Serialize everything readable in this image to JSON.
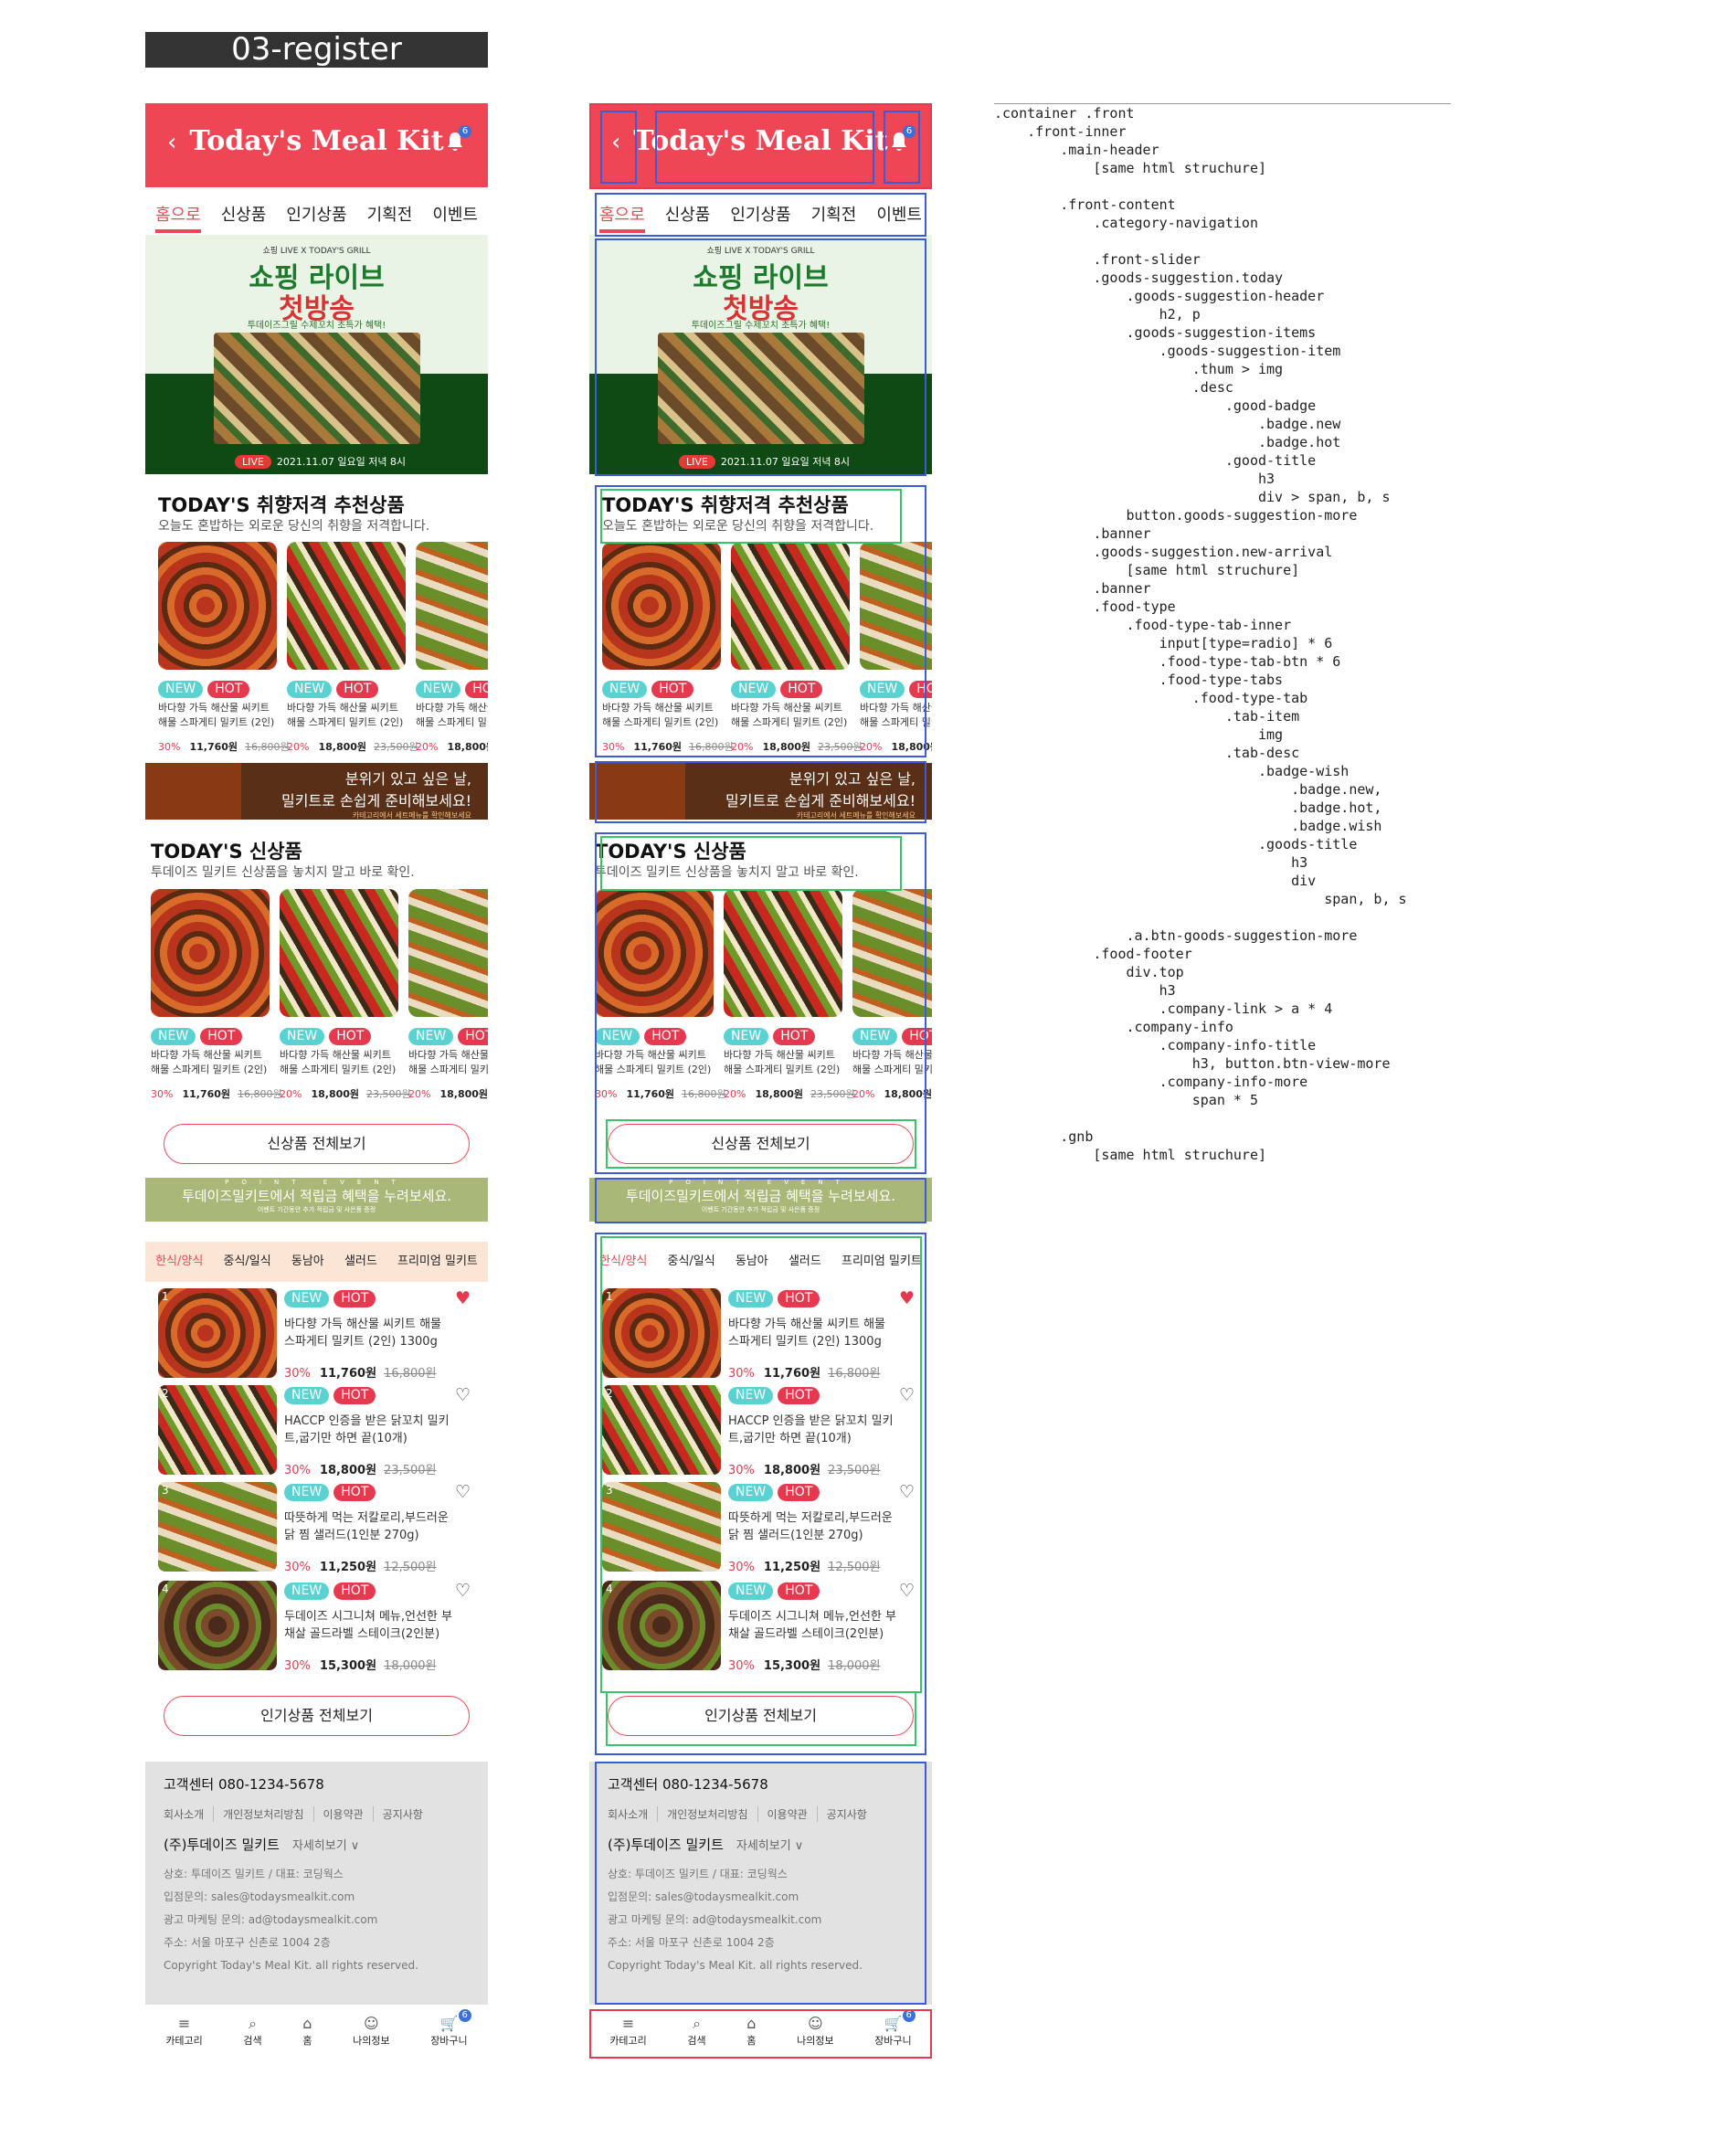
{
  "frame_title": "03-register",
  "header": {
    "back": "‹",
    "logo": "Today's Meal Kit",
    "notif_count": "6"
  },
  "categories": [
    "홈으로",
    "신상품",
    "인기상품",
    "기획전",
    "이벤트"
  ],
  "hero": {
    "tag": "쇼핑 LIVE X TODAY'S GRILL",
    "title1": "쇼핑 라이브",
    "title2": "첫방송",
    "sub": "투데이즈그릴 수제꼬치 초특가 혜택!",
    "live_label": "LIVE",
    "live_date": "2021.11.07 일요일 저녁 8시"
  },
  "today": {
    "title": "TODAY'S 취향저격 추천상품",
    "sub": "오늘도 혼밥하는 외로운 당신의 취향을 저격합니다.",
    "items": [
      {
        "new": "NEW",
        "hot": "HOT",
        "name": "바다향 가득 해산물 씨키트 해물 스파게티 밀키트 (2인)",
        "pct": "30%",
        "price": "11,760원",
        "old": "16,800원"
      },
      {
        "new": "NEW",
        "hot": "HOT",
        "name": "바다향 가득 해산물 씨키트 해물 스파게티 밀키트 (2인)",
        "pct": "20%",
        "price": "18,800원",
        "old": "23,500원"
      },
      {
        "new": "NEW",
        "hot": "HOT",
        "name": "바다향 가득 해산물 씨키트 해물 스파게티 밀키트",
        "pct": "20%",
        "price": "18,800원",
        "old": ""
      }
    ]
  },
  "banner1": {
    "l1": "분위기 있고 싶은 날,",
    "l2": "밀키트로 손쉽게 준비해보세요!",
    "l3": "카테고리에서 세트메뉴를 확인해보세요"
  },
  "new_arrival": {
    "title": "TODAY'S 신상품",
    "sub": "투데이즈 밀키트 신상품을 놓치지 말고 바로 확인.",
    "items": [
      {
        "new": "NEW",
        "hot": "HOT",
        "name": "바다향 가득 해산물 씨키트 해물 스파게티 밀키트 (2인)",
        "pct": "30%",
        "price": "11,760원",
        "old": "16,800원"
      },
      {
        "new": "NEW",
        "hot": "HOT",
        "name": "바다향 가득 해산물 씨키트 해물 스파게티 밀키트 (2인)",
        "pct": "20%",
        "price": "18,800원",
        "old": "23,500원"
      },
      {
        "new": "NEW",
        "hot": "HOT",
        "name": "바다향 가득 해산물 씨키트 해물 스파게티 밀키트",
        "pct": "20%",
        "price": "18,800원",
        "old": ""
      }
    ],
    "more": "신상품 전체보기"
  },
  "banner2": {
    "pt": "POINT EVENT",
    "l1": "투데이즈밀키트에서 적립금 혜택을 누려보세요.",
    "l2": "이벤트 기간동안 추가 적립금 및 사은품 증정"
  },
  "food_tabs": [
    "한식/양식",
    "중식/일식",
    "동남아",
    "샐러드",
    "프리미엄 밀키트"
  ],
  "ranking": [
    {
      "rank": "1",
      "new": "NEW",
      "hot": "HOT",
      "name": "바다향 가득 해산물 씨키트 해물 스파게티 밀키트 (2인) 1300g",
      "pct": "30%",
      "price": "11,760원",
      "old": "16,800원"
    },
    {
      "rank": "2",
      "new": "NEW",
      "hot": "HOT",
      "name": "HACCP 인증을 받은 닭꼬치 밀키트,굽기만 하면 끝(10개)",
      "pct": "30%",
      "price": "18,800원",
      "old": "23,500원"
    },
    {
      "rank": "3",
      "new": "NEW",
      "hot": "HOT",
      "name": "따뜻하게 먹는 저칼로리,부드러운 닭 찜 샐러드(1인분 270g)",
      "pct": "30%",
      "price": "11,250원",
      "old": "12,500원"
    },
    {
      "rank": "4",
      "new": "NEW",
      "hot": "HOT",
      "name": "두데이즈 시그니쳐 메뉴,언선한 부채살 골드라벨 스테이크(2인분)",
      "pct": "30%",
      "price": "15,300원",
      "old": "18,000원"
    }
  ],
  "ranking_more": "인기상품 전체보기",
  "footer": {
    "cc": "고객센터 080-1234-5678",
    "links": [
      "회사소개",
      "개인정보처리방침",
      "이용약관",
      "공지사항"
    ],
    "company": "(주)투데이즈 밀키트",
    "detail": "자세히보기 ∨",
    "info": [
      "상호: 투데이즈 밀키트 / 대표: 코딩웍스",
      "입점문의: sales@todaysmealkit.com",
      "광고 마케팅 문의: ad@todaysmealkit.com",
      "주소: 서울 마포구 신촌로 1004 2층",
      "Copyright Today's Meal Kit. all rights reserved."
    ]
  },
  "gnb": [
    {
      "icon": "≡",
      "label": "카테고리"
    },
    {
      "icon": "⌕",
      "label": "검색"
    },
    {
      "icon": "⌂",
      "label": "홈"
    },
    {
      "icon": "☺",
      "label": "나의정보"
    },
    {
      "icon": "🛒",
      "label": "장바구니"
    }
  ],
  "cart_count": "6",
  "tree_text": ".container .front\n    .front-inner\n        .main-header\n            [same html struchure]\n\n        .front-content\n            .category-navigation\n\n            .front-slider\n            .goods-suggestion.today\n                .goods-suggestion-header\n                    h2, p\n                .goods-suggestion-items\n                    .goods-suggestion-item\n                        .thum > img\n                        .desc\n                            .good-badge\n                                .badge.new\n                                .badge.hot\n                            .good-title\n                                h3\n                                div > span, b, s\n                button.goods-suggestion-more\n            .banner\n            .goods-suggestion.new-arrival\n                [same html struchure]\n            .banner\n            .food-type\n                .food-type-tab-inner\n                    input[type=radio] * 6\n                    .food-type-tab-btn * 6\n                    .food-type-tabs\n                        .food-type-tab\n                            .tab-item\n                                img\n                            .tab-desc\n                                .badge-wish\n                                    .badge.new,\n                                    .badge.hot,\n                                    .badge.wish\n                                .goods-title\n                                    h3\n                                    div\n                                        span, b, s\n\n                .a.btn-goods-suggestion-more\n            .food-footer\n                div.top\n                    h3\n                    .company-link > a * 4\n                .company-info\n                    .company-info-title\n                        h3, button.btn-view-more\n                    .company-info-more\n                        span * 5\n\n        .gnb\n            [same html struchure]"
}
